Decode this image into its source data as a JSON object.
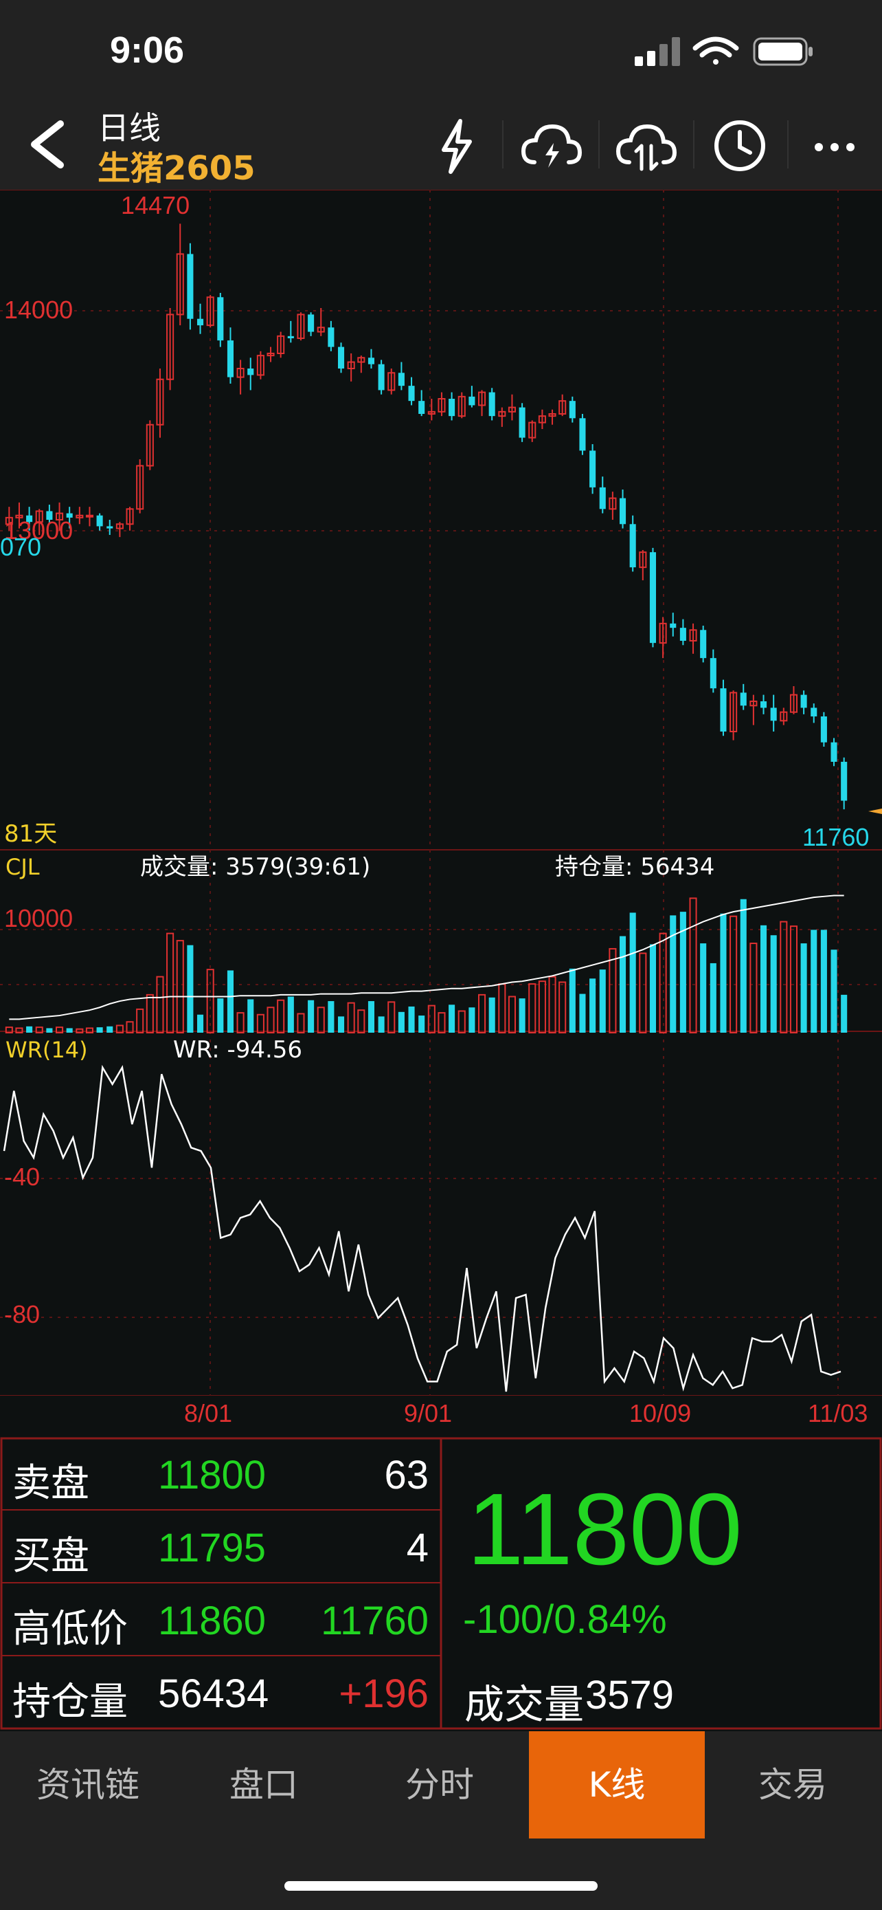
{
  "status": {
    "time": "9:06"
  },
  "header": {
    "title": "日线",
    "subtitle": "生猪2605",
    "icons": [
      "back-icon",
      "flash-icon",
      "cloud-flash-icon",
      "cloud-sync-icon",
      "clock-icon",
      "more-icon"
    ]
  },
  "kline": {
    "high_label": "14470",
    "y_labels": [
      "14000",
      "13000"
    ],
    "left_cut_label": "070",
    "days_label": "81天",
    "last_price_label": "11760"
  },
  "volume": {
    "title": "CJL",
    "volume_text": "成交量: 3579(39:61)",
    "oi_text": "持仓量: 56434",
    "y_label": "10000"
  },
  "wr": {
    "title": "WR(14)",
    "value_text": "WR: -94.56",
    "y_labels": [
      "-40",
      "-80"
    ]
  },
  "x_axis": [
    "8/01",
    "9/01",
    "10/09",
    "11/03"
  ],
  "chart_data": [
    {
      "type": "candlestick",
      "title": "",
      "ylim": [
        11700,
        14500
      ],
      "x_labels": [
        "8/01",
        "9/01",
        "10/09",
        "11/03"
      ],
      "ohlc": [
        [
          13080,
          13160,
          13050,
          13110
        ],
        [
          13110,
          13180,
          13060,
          13120
        ],
        [
          13120,
          13160,
          13050,
          13090
        ],
        [
          13090,
          13150,
          13030,
          13140
        ],
        [
          13140,
          13170,
          13080,
          13100
        ],
        [
          13100,
          13180,
          13050,
          13130
        ],
        [
          13130,
          13160,
          13060,
          13110
        ],
        [
          13110,
          13160,
          13080,
          13120
        ],
        [
          13120,
          13160,
          13070,
          13120
        ],
        [
          13120,
          13130,
          13050,
          13070
        ],
        [
          13070,
          13100,
          13030,
          13060
        ],
        [
          13060,
          13090,
          13020,
          13080
        ],
        [
          13080,
          13160,
          13050,
          13150
        ],
        [
          13150,
          13380,
          13130,
          13350
        ],
        [
          13350,
          13560,
          13330,
          13540
        ],
        [
          13540,
          13800,
          13480,
          13750
        ],
        [
          13750,
          14080,
          13700,
          14050
        ],
        [
          14050,
          14470,
          14000,
          14330
        ],
        [
          14330,
          14380,
          13980,
          14030
        ],
        [
          14030,
          14100,
          13960,
          14000
        ],
        [
          14000,
          14140,
          13990,
          14130
        ],
        [
          14130,
          14150,
          13900,
          13930
        ],
        [
          13930,
          13990,
          13730,
          13760
        ],
        [
          13760,
          13840,
          13680,
          13800
        ],
        [
          13800,
          13850,
          13700,
          13770
        ],
        [
          13770,
          13880,
          13750,
          13860
        ],
        [
          13860,
          13900,
          13830,
          13870
        ],
        [
          13870,
          13970,
          13850,
          13950
        ],
        [
          13950,
          14020,
          13920,
          13940
        ],
        [
          13940,
          14060,
          13930,
          14050
        ],
        [
          14050,
          14060,
          13950,
          13970
        ],
        [
          13970,
          14080,
          13950,
          13990
        ],
        [
          13990,
          14020,
          13880,
          13900
        ],
        [
          13900,
          13920,
          13780,
          13800
        ],
        [
          13800,
          13870,
          13740,
          13830
        ],
        [
          13830,
          13860,
          13780,
          13850
        ],
        [
          13850,
          13890,
          13800,
          13820
        ],
        [
          13820,
          13840,
          13680,
          13700
        ],
        [
          13700,
          13800,
          13680,
          13780
        ],
        [
          13780,
          13830,
          13700,
          13720
        ],
        [
          13720,
          13760,
          13630,
          13650
        ],
        [
          13650,
          13700,
          13580,
          13590
        ],
        [
          13590,
          13660,
          13560,
          13600
        ],
        [
          13600,
          13690,
          13580,
          13660
        ],
        [
          13660,
          13690,
          13560,
          13580
        ],
        [
          13580,
          13690,
          13570,
          13670
        ],
        [
          13670,
          13720,
          13620,
          13630
        ],
        [
          13630,
          13700,
          13580,
          13690
        ],
        [
          13690,
          13710,
          13560,
          13580
        ],
        [
          13580,
          13620,
          13530,
          13600
        ],
        [
          13600,
          13680,
          13560,
          13620
        ],
        [
          13620,
          13640,
          13460,
          13480
        ],
        [
          13480,
          13560,
          13460,
          13550
        ],
        [
          13550,
          13610,
          13520,
          13580
        ],
        [
          13580,
          13610,
          13540,
          13590
        ],
        [
          13590,
          13680,
          13580,
          13650
        ],
        [
          13650,
          13670,
          13550,
          13570
        ],
        [
          13570,
          13590,
          13400,
          13420
        ],
        [
          13420,
          13450,
          13220,
          13250
        ],
        [
          13250,
          13300,
          13130,
          13150
        ],
        [
          13150,
          13230,
          13100,
          13200
        ],
        [
          13200,
          13240,
          13060,
          13080
        ],
        [
          13080,
          13120,
          12860,
          12880
        ],
        [
          12880,
          12960,
          12820,
          12950
        ],
        [
          12950,
          12970,
          12510,
          12530
        ],
        [
          12530,
          12650,
          12460,
          12620
        ],
        [
          12620,
          12670,
          12560,
          12600
        ],
        [
          12600,
          12640,
          12520,
          12540
        ],
        [
          12540,
          12620,
          12480,
          12590
        ],
        [
          12590,
          12610,
          12440,
          12460
        ],
        [
          12460,
          12500,
          12300,
          12320
        ],
        [
          12320,
          12360,
          12100,
          12120
        ],
        [
          12120,
          12310,
          12080,
          12300
        ],
        [
          12300,
          12340,
          12220,
          12240
        ],
        [
          12240,
          12290,
          12150,
          12260
        ],
        [
          12260,
          12290,
          12200,
          12230
        ],
        [
          12230,
          12290,
          12120,
          12170
        ],
        [
          12170,
          12230,
          12150,
          12210
        ],
        [
          12210,
          12330,
          12200,
          12290
        ],
        [
          12290,
          12310,
          12200,
          12230
        ],
        [
          12230,
          12250,
          12160,
          12190
        ],
        [
          12190,
          12210,
          12050,
          12070
        ],
        [
          12070,
          12090,
          11960,
          11980
        ],
        [
          11980,
          12000,
          11760,
          11800
        ]
      ]
    },
    {
      "type": "bar",
      "title": "CJL",
      "ylim": [
        0,
        16000
      ],
      "series": [
        {
          "name": "成交量",
          "values": [
            600,
            500,
            700,
            600,
            500,
            600,
            500,
            400,
            500,
            600,
            700,
            800,
            1200,
            2600,
            4200,
            6200,
            11000,
            10200,
            9700,
            2000,
            7000,
            3800,
            6900,
            2200,
            3700,
            2000,
            2800,
            3600,
            4000,
            2100,
            3600,
            2800,
            3500,
            1800,
            3300,
            2500,
            3500,
            1800,
            3400,
            2300,
            2900,
            1900,
            3000,
            2200,
            3100,
            2400,
            2800,
            4200,
            3900,
            5400,
            4000,
            3800,
            5400,
            5700,
            6200,
            5600,
            7100,
            4300,
            6000,
            7000,
            9300,
            10700,
            13300,
            8800,
            9800,
            11000,
            13000,
            13400,
            14900,
            9900,
            7700,
            13200,
            12900,
            14800,
            9900,
            11900,
            10800,
            12300,
            11800,
            9900,
            11400,
            11400,
            9200,
            4200
          ]
        },
        {
          "name": "持仓量",
          "values": [
            1500,
            1500,
            1600,
            1700,
            1800,
            1900,
            2100,
            2300,
            2500,
            2800,
            3200,
            3500,
            3700,
            3800,
            3900,
            3900,
            4000,
            4000,
            4000,
            4000,
            4000,
            4000,
            4000,
            4100,
            4100,
            4100,
            4100,
            4200,
            4200,
            4200,
            4200,
            4300,
            4300,
            4300,
            4300,
            4400,
            4400,
            4400,
            4400,
            4500,
            4600,
            4600,
            4700,
            4800,
            4900,
            4900,
            5000,
            5100,
            5200,
            5400,
            5600,
            5700,
            5900,
            6100,
            6300,
            6600,
            6900,
            7200,
            7500,
            7800,
            8100,
            8400,
            8800,
            9200,
            9700,
            10200,
            10800,
            11300,
            11800,
            12300,
            12700,
            13100,
            13400,
            13600,
            13800,
            14000,
            14200,
            14400,
            14600,
            14800,
            15000,
            15100,
            15200,
            15200
          ]
        }
      ]
    },
    {
      "type": "line",
      "title": "WR(14)",
      "ylim": [
        -100,
        0
      ],
      "series": [
        {
          "name": "WR",
          "values": [
            -28,
            -10,
            -25,
            -30,
            -17,
            -22,
            -30,
            -24,
            -36,
            -30,
            -3,
            -8,
            -3,
            -20,
            -10,
            -33,
            -5,
            -14,
            -20,
            -27,
            -28,
            -33,
            -54,
            -53,
            -48,
            -47,
            -43,
            -48,
            -51,
            -57,
            -64,
            -62,
            -57,
            -65,
            -52,
            -70,
            -56,
            -71,
            -78,
            -75,
            -72,
            -80,
            -90,
            -97,
            -97,
            -88,
            -86,
            -63,
            -87,
            -78,
            -70,
            -100,
            -72,
            -71,
            -96,
            -75,
            -60,
            -53,
            -48,
            -54,
            -46,
            -97,
            -93,
            -97,
            -88,
            -90,
            -97,
            -84,
            -87,
            -99,
            -89,
            -96,
            -98,
            -94,
            -99,
            -98,
            -84,
            -85,
            -85,
            -83,
            -91,
            -79,
            -77,
            -94,
            -95,
            -94
          ]
        }
      ]
    }
  ],
  "quote": {
    "rows": [
      {
        "label": "卖盘",
        "v1": "11800",
        "v2": "63"
      },
      {
        "label": "买盘",
        "v1": "11795",
        "v2": "4"
      },
      {
        "label": "高低价",
        "v1": "11860",
        "v2": "11760"
      },
      {
        "label": "持仓量",
        "v1": "56434",
        "v2": "+196"
      }
    ],
    "last_price": "11800",
    "change": "-100/0.84%",
    "volume_label": "成交量",
    "volume_value": "3579"
  },
  "tabs": [
    {
      "label": "资讯链",
      "active": false
    },
    {
      "label": "盘口",
      "active": false
    },
    {
      "label": "分时",
      "active": false
    },
    {
      "label": "K线",
      "active": true
    },
    {
      "label": "交易",
      "active": false
    }
  ],
  "colors": {
    "up": "#e03131",
    "down": "#26d8ea",
    "green": "#22d622",
    "accent": "#e8650a",
    "title_yellow": "#f2b132"
  }
}
